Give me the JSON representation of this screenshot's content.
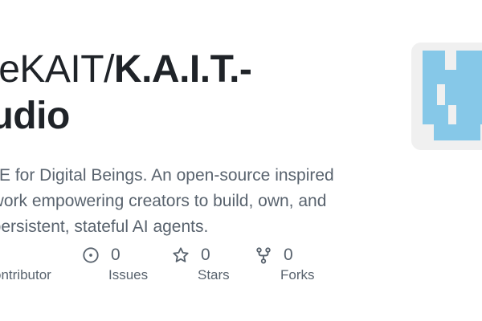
{
  "repo": {
    "owner": "eeKAIT/",
    "name": "K.A.I.T.-",
    "name_line2": "tudio"
  },
  "description": "IDE for Digital Beings. An open-source inspired\nework empowering creators to build, own, and\n/ persistent, stateful AI agents.",
  "description_lines": [
    "IDE for Digital Beings. An open-source inspired",
    "ework empowering creators to build, own, and",
    "/ persistent, stateful AI agents."
  ],
  "stats": {
    "contributors": {
      "label": "ontributor"
    },
    "issues": {
      "count": "0",
      "label": "Issues",
      "icon": "issue-opened-icon"
    },
    "stars": {
      "count": "0",
      "label": "Stars",
      "icon": "star-icon"
    },
    "forks": {
      "count": "0",
      "label": "Forks",
      "icon": "repo-forked-icon"
    }
  },
  "colors": {
    "title": "#1f2328",
    "muted": "#59636e",
    "avatar_bg": "#f0f0f0",
    "avatar_fg": "#86c8e8"
  }
}
